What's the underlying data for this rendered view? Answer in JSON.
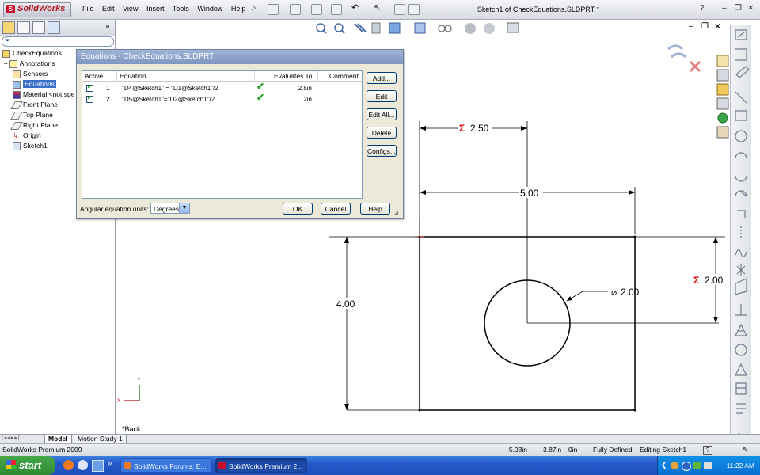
{
  "app": {
    "logo_text": "SolidWorks",
    "document_title": "Sketch1 of CheckEquations.SLDPRT *"
  },
  "menu": [
    "File",
    "Edit",
    "View",
    "Insert",
    "Tools",
    "Window",
    "Help"
  ],
  "feature_tree": {
    "root": "CheckEquations",
    "items": [
      {
        "label": "Annotations",
        "icon": "annotations-icon"
      },
      {
        "label": "Sensors",
        "icon": "sensors-icon"
      },
      {
        "label": "Equations",
        "icon": "equations-icon",
        "selected": true
      },
      {
        "label": "Material <not spe",
        "icon": "material-icon"
      },
      {
        "label": "Front Plane",
        "icon": "plane-icon"
      },
      {
        "label": "Top Plane",
        "icon": "plane-icon"
      },
      {
        "label": "Right Plane",
        "icon": "plane-icon"
      },
      {
        "label": "Origin",
        "icon": "origin-icon"
      },
      {
        "label": "Sketch1",
        "icon": "sketch-icon"
      }
    ]
  },
  "dialog": {
    "title": "Equations - CheckEquations.SLDPRT",
    "columns": [
      "Active",
      "Equation",
      "Evaluates To",
      "Comment"
    ],
    "rows": [
      {
        "num": "1",
        "equation": "\"D4@Sketch1\" = \"D1@Sketch1\"/2",
        "evaluates_to": "2.5in",
        "comment": ""
      },
      {
        "num": "2",
        "equation": "\"D5@Sketch1\"=\"D2@Sketch1\"/2",
        "evaluates_to": "2in",
        "comment": ""
      }
    ],
    "side_buttons": [
      "Add...",
      "Edit",
      "Edit All...",
      "Delete",
      "Configs..."
    ],
    "angular_label": "Angular equation units:",
    "angular_value": "Degrees",
    "ok": "OK",
    "cancel": "Cancel",
    "help": "Help"
  },
  "sketch": {
    "dim_top_half": "2.50",
    "dim_width": "5.00",
    "dim_height": "4.00",
    "dim_right_half": "2.00",
    "dim_diameter": "2.00",
    "sigma": "Σ",
    "diameter_symbol": "⌀",
    "view_label": "*Back",
    "axis_x": "X",
    "axis_y": "Y"
  },
  "bottom_tabs": [
    "Model",
    "Motion Study 1"
  ],
  "status": {
    "product": "SolidWorks Premium 2009",
    "x": "-5.03in",
    "y": "3.87in",
    "z": "0in",
    "state": "Fully Defined",
    "editing": "Editing Sketch1"
  },
  "taskbar": {
    "start": "start",
    "tasks": [
      "SolidWorks Forums: E...",
      "SolidWorks Premium 2..."
    ],
    "clock": "11:22 AM"
  }
}
